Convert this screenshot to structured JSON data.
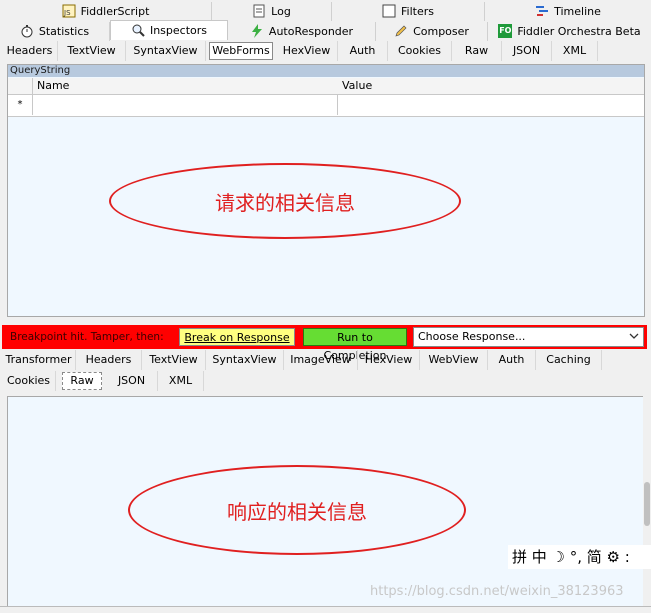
{
  "top_tabs_row1": [
    {
      "label": "FiddlerScript",
      "icon": "script-icon"
    },
    {
      "label": "Log",
      "icon": "log-icon"
    },
    {
      "label": "Filters",
      "icon": "checkbox-icon"
    },
    {
      "label": "Timeline",
      "icon": "timeline-icon"
    }
  ],
  "top_tabs_row2": [
    {
      "label": "Statistics",
      "icon": "stopwatch-icon"
    },
    {
      "label": "Inspectors",
      "icon": "magnifier-icon"
    },
    {
      "label": "AutoResponder",
      "icon": "lightning-icon"
    },
    {
      "label": "Composer",
      "icon": "pencil-icon"
    },
    {
      "label": "Fiddler Orchestra Beta",
      "icon": "fo-icon",
      "icon_text": "FO"
    }
  ],
  "request_tabs": [
    "Headers",
    "TextView",
    "SyntaxView",
    "WebForms",
    "HexView",
    "Auth",
    "Cookies",
    "Raw",
    "JSON",
    "XML"
  ],
  "request_active_tab": "WebForms",
  "querystring": {
    "title": "QueryString",
    "col_name": "Name",
    "col_value": "Value",
    "new_row_marker": "*"
  },
  "request_annotation": "请求的相关信息",
  "breakpoint_bar": {
    "text": "Breakpoint hit. Tamper, then:",
    "break_on_response": "Break on Response",
    "run_to_completion": "Run to Completion",
    "choose_response": "Choose Response..."
  },
  "response_tabs_row1": [
    "Transformer",
    "Headers",
    "TextView",
    "SyntaxView",
    "ImageView",
    "HexView",
    "WebView",
    "Auth",
    "Caching"
  ],
  "response_tabs_row2": [
    "Cookies",
    "Raw",
    "JSON",
    "XML"
  ],
  "response_active_tab": "Raw",
  "response_annotation": "响应的相关信息",
  "ime_toolbar": "拼 中 ☽ °, 简 ⚙ :",
  "watermark": "https://blog.csdn.net/weixin_38123963",
  "colors": {
    "breakpoint_red": "#ff0000",
    "break_yellow": "#ffff80",
    "run_green": "#66dd33",
    "annotation_red": "#e02020",
    "panel_bg": "#f0f8ff"
  }
}
